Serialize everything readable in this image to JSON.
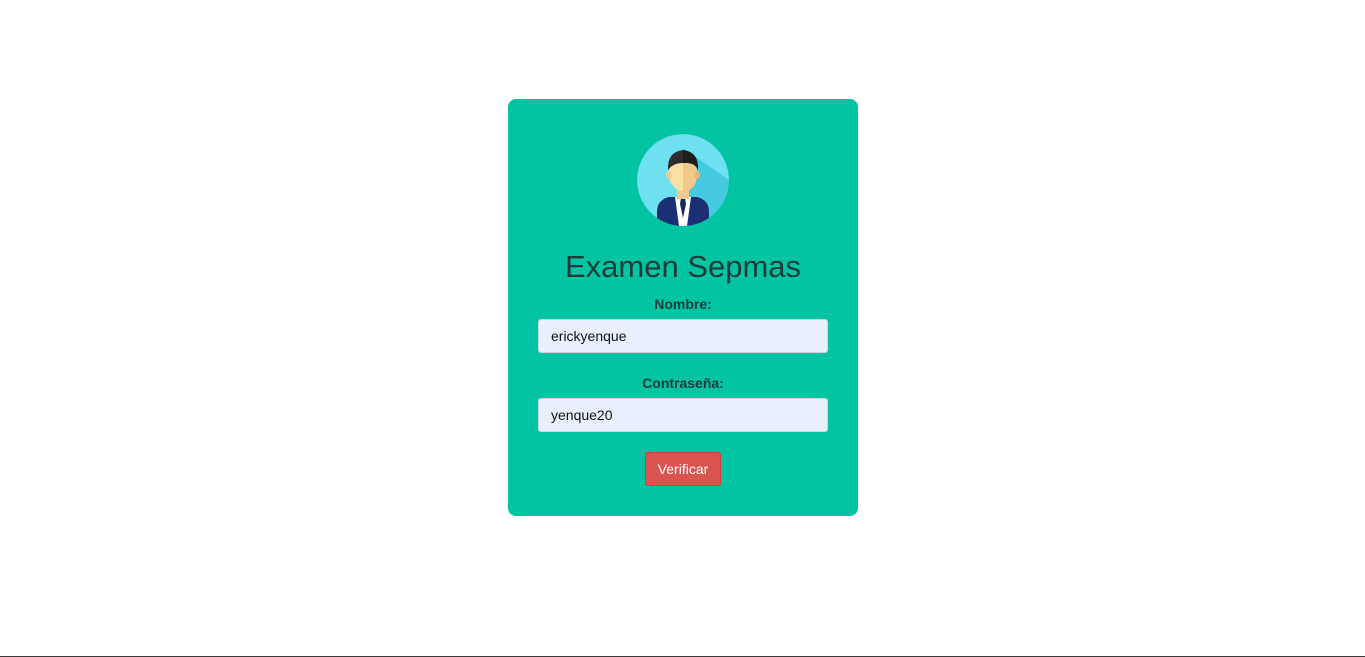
{
  "login_card": {
    "title": "Examen Sepmas",
    "avatar_icon": "user-avatar-icon",
    "nombre_label": "Nombre:",
    "nombre_value": "erickyenque",
    "password_label": "Contraseña:",
    "password_value": "yenque20",
    "submit_label": "Verificar"
  },
  "colors": {
    "card_background": "#02c4a3",
    "button_background": "#d9534f",
    "input_background": "#e8f0fe",
    "title_text": "#1f3b3a"
  }
}
